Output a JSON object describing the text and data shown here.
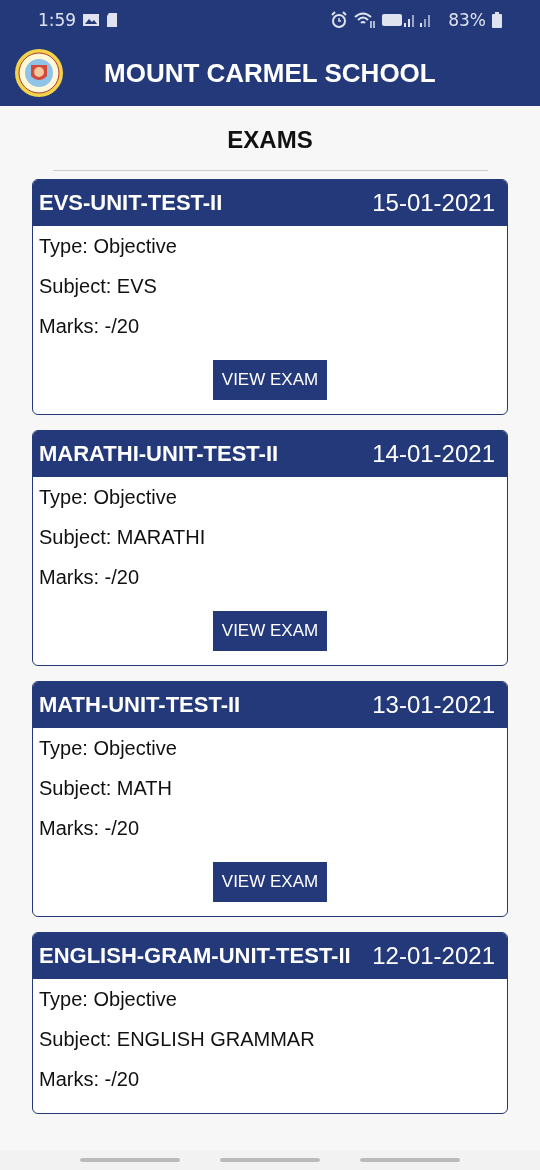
{
  "status_bar": {
    "time": "1:59",
    "battery": "83%"
  },
  "app_bar": {
    "title": "MOUNT CARMEL SCHOOL"
  },
  "page_title": "EXAMS",
  "exams": [
    {
      "title": "EVS-UNIT-TEST-II",
      "date": "15-01-2021",
      "type": "Type: Objective",
      "subject": "Subject: EVS",
      "marks": "Marks: -/20",
      "button": "VIEW EXAM"
    },
    {
      "title": "MARATHI-UNIT-TEST-II",
      "date": "14-01-2021",
      "type": "Type: Objective",
      "subject": "Subject: MARATHI",
      "marks": "Marks: -/20",
      "button": "VIEW EXAM"
    },
    {
      "title": "MATH-UNIT-TEST-II",
      "date": "13-01-2021",
      "type": "Type: Objective",
      "subject": "Subject: MATH",
      "marks": "Marks: -/20",
      "button": "VIEW EXAM"
    },
    {
      "title": "ENGLISH-GRAM-UNIT-TEST-II",
      "date": "12-01-2021",
      "type": "Type: Objective",
      "subject": "Subject: ENGLISH GRAMMAR",
      "marks": "Marks: -/20"
    }
  ]
}
